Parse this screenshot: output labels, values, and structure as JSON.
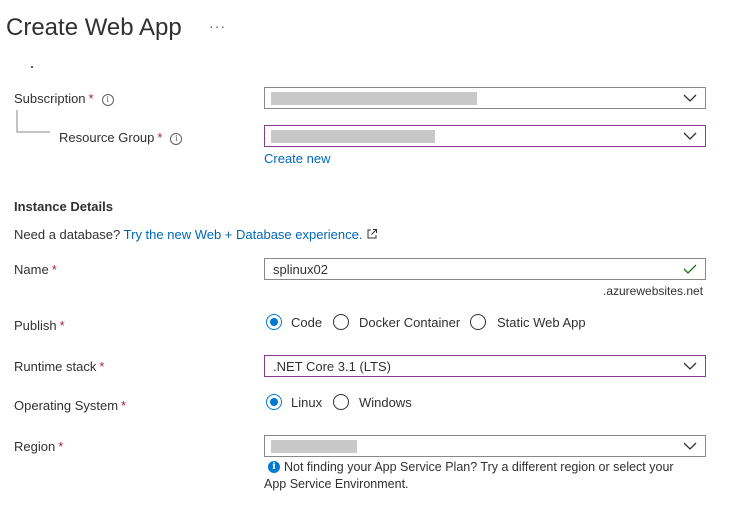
{
  "header": {
    "title": "Create Web App",
    "more": "···"
  },
  "subscription": {
    "label": "Subscription",
    "required": "*"
  },
  "resource_group": {
    "label": "Resource Group",
    "required": "*",
    "create_new": "Create new"
  },
  "instance": {
    "heading": "Instance Details",
    "db_prompt": "Need a database?",
    "db_link": "Try the new Web + Database experience."
  },
  "name": {
    "label": "Name",
    "required": "*",
    "value": "splinux02",
    "suffix": ".azurewebsites.net"
  },
  "publish": {
    "label": "Publish",
    "required": "*",
    "options": [
      "Code",
      "Docker Container",
      "Static Web App"
    ],
    "selected": "Code"
  },
  "runtime": {
    "label": "Runtime stack",
    "required": "*",
    "value": ".NET Core 3.1 (LTS)"
  },
  "os": {
    "label": "Operating System",
    "required": "*",
    "options": [
      "Linux",
      "Windows"
    ],
    "selected": "Linux"
  },
  "region": {
    "label": "Region",
    "required": "*",
    "hint_line1": "Not finding your App Service Plan? Try a different region or select your",
    "hint_line2": "App Service Environment."
  },
  "colors": {
    "accent": "#0078d4",
    "link": "#0067b8",
    "focus_border": "#8a3b8f",
    "required": "#a4262c"
  }
}
